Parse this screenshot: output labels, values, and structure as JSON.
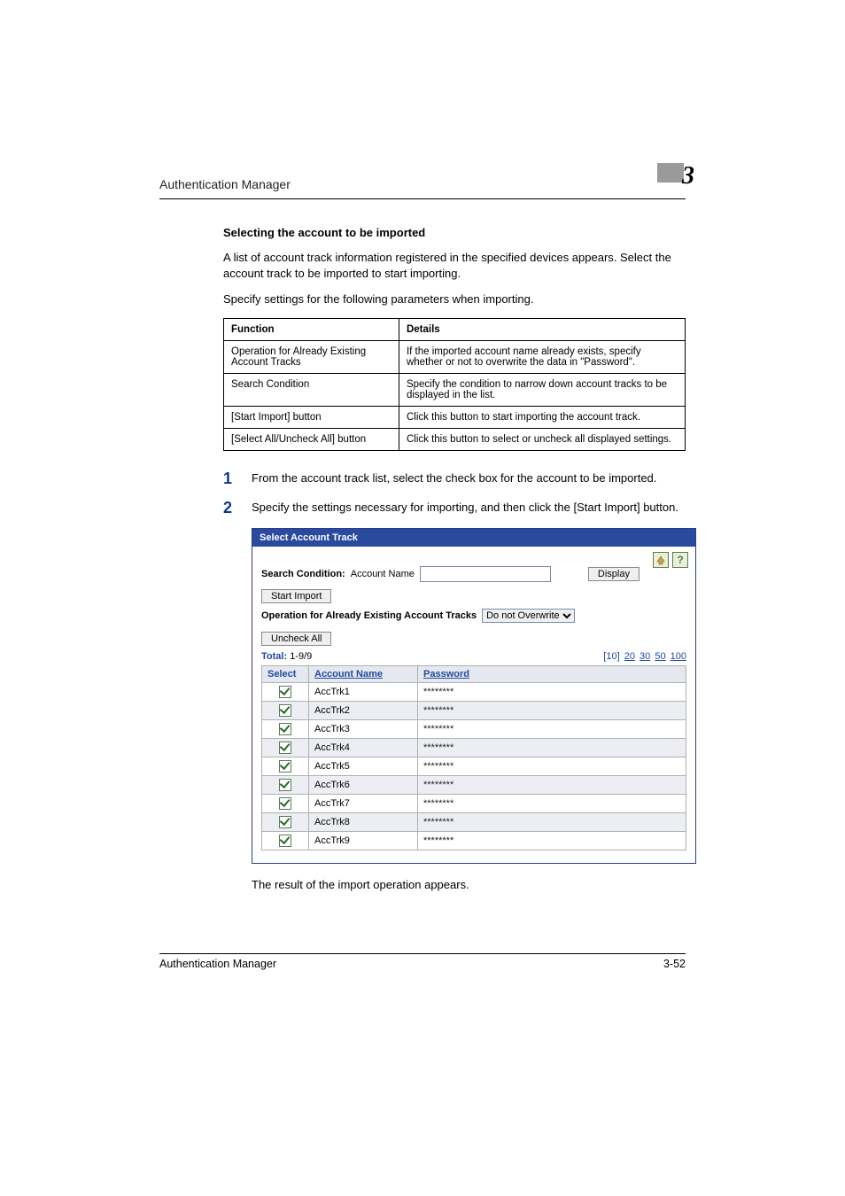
{
  "header": {
    "title": "Authentication Manager",
    "chapter_number": "3"
  },
  "section": {
    "heading": "Selecting the account to be imported",
    "para1": "A list of account track information registered in the specified devices appears. Select the account track to be imported to start importing.",
    "para2": "Specify settings for the following parameters when importing."
  },
  "fd_table": {
    "head_function": "Function",
    "head_details": "Details",
    "rows": [
      {
        "f": "Operation for Already Existing Account Tracks",
        "d": "If the imported account name already exists, specify whether or not to overwrite the data in \"Password\"."
      },
      {
        "f": "Search Condition",
        "d": "Specify the condition to narrow down account tracks to be displayed in the list."
      },
      {
        "f": "[Start Import] button",
        "d": "Click this button to start importing the account track."
      },
      {
        "f": "[Select All/Uncheck All] button",
        "d": "Click this button to select or uncheck all displayed settings."
      }
    ]
  },
  "steps": {
    "s1_num": "1",
    "s1_text": "From the account track list, select the check box for the account to be imported.",
    "s2_num": "2",
    "s2_text": "Specify the settings necessary for importing, and then click the [Start Import] button."
  },
  "shot": {
    "title": "Select Account Track",
    "icons": {
      "up_name": "up-icon",
      "help_name": "help-icon",
      "help_glyph": "?"
    },
    "search": {
      "label": "Search Condition:",
      "field_label": "Account Name",
      "value": "",
      "display_btn": "Display"
    },
    "start_import_btn": "Start Import",
    "op_label": "Operation for Already Existing Account Tracks",
    "op_selected": "Do not Overwrite",
    "uncheck_btn": "Uncheck All",
    "total_label": "Total:",
    "total_value": "1-9/9",
    "pager": {
      "current": "[10]",
      "p20": "20",
      "p30": "30",
      "p50": "50",
      "p100": "100"
    },
    "cols": {
      "select": "Select",
      "account": "Account Name",
      "password": "Password"
    },
    "rows": [
      {
        "name": "AccTrk1",
        "pw": "********"
      },
      {
        "name": "AccTrk2",
        "pw": "********"
      },
      {
        "name": "AccTrk3",
        "pw": "********"
      },
      {
        "name": "AccTrk4",
        "pw": "********"
      },
      {
        "name": "AccTrk5",
        "pw": "********"
      },
      {
        "name": "AccTrk6",
        "pw": "********"
      },
      {
        "name": "AccTrk7",
        "pw": "********"
      },
      {
        "name": "AccTrk8",
        "pw": "********"
      },
      {
        "name": "AccTrk9",
        "pw": "********"
      }
    ]
  },
  "result_text": "The result of the import operation appears.",
  "footer": {
    "left": "Authentication Manager",
    "right": "3-52"
  }
}
